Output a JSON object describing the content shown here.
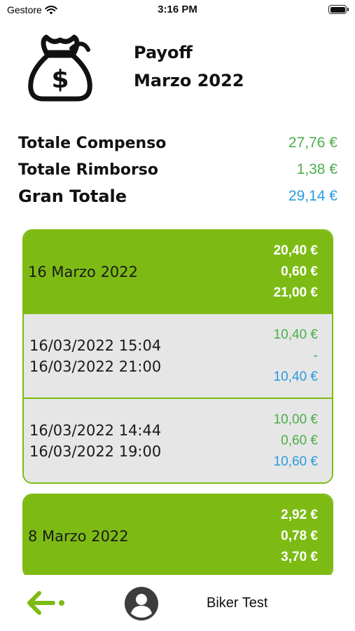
{
  "status_bar": {
    "carrier": "Gestore",
    "time": "3:16 PM"
  },
  "header": {
    "title": "Payoff",
    "month": "Marzo 2022",
    "icon": "money-bag-icon"
  },
  "totals": [
    {
      "label": "Totale Compenso",
      "value": "27,76 €",
      "color": "#4cae4c"
    },
    {
      "label": "Totale Rimborso",
      "value": "1,38 €",
      "color": "#4cae4c"
    },
    {
      "label": "Gran Totale",
      "value": "29,14 €",
      "color": "#2a9be0"
    }
  ],
  "groups": [
    {
      "date": "16 Marzo 2022",
      "amounts": [
        "20,40 €",
        "0,60 €",
        "21,00 €"
      ],
      "entries": [
        {
          "start": "16/03/2022 15:04",
          "end": "16/03/2022 21:00",
          "compenso": "10,40 €",
          "rimborso": "-",
          "totale": "10,40 €"
        },
        {
          "start": "16/03/2022 14:44",
          "end": "16/03/2022 19:00",
          "compenso": "10,00 €",
          "rimborso": "0,60 €",
          "totale": "10,60 €"
        }
      ]
    },
    {
      "date": "8 Marzo 2022",
      "amounts": [
        "2,92 €",
        "0,78 €",
        "3,70 €"
      ],
      "entries": []
    }
  ],
  "bottom_bar": {
    "back_icon": "arrow-left-icon",
    "profile_icon": "user-avatar-icon",
    "user_name": "Biker Test"
  },
  "colors": {
    "accent_green": "#7dbb14",
    "value_green": "#4cae4c",
    "value_blue": "#2a9be0",
    "entry_bg": "#e6e6e6"
  }
}
